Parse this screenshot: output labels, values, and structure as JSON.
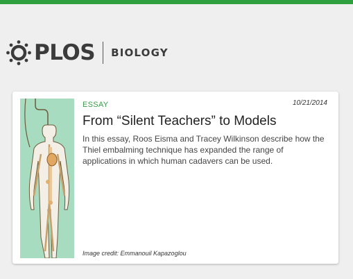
{
  "brand": {
    "wordmark": "PLOS",
    "journal": "BIOLOGY",
    "accent_color": "#2e9e3e"
  },
  "article": {
    "category": "ESSAY",
    "date": "10/21/2014",
    "title": "From “Silent Teachers” to Models",
    "summary": "In this essay, Roos Eisma and Tracey Wilkinson describe how the Thiel embalming technique has expanded the range of applications in which human cadavers can be used.",
    "image_credit": "Image credit: Emmanouil Kapazoglou"
  },
  "colors": {
    "background": "#efefef",
    "card": "#ffffff",
    "category_green": "#3a9a4a",
    "illustration_bg": "#a8dcc0"
  }
}
